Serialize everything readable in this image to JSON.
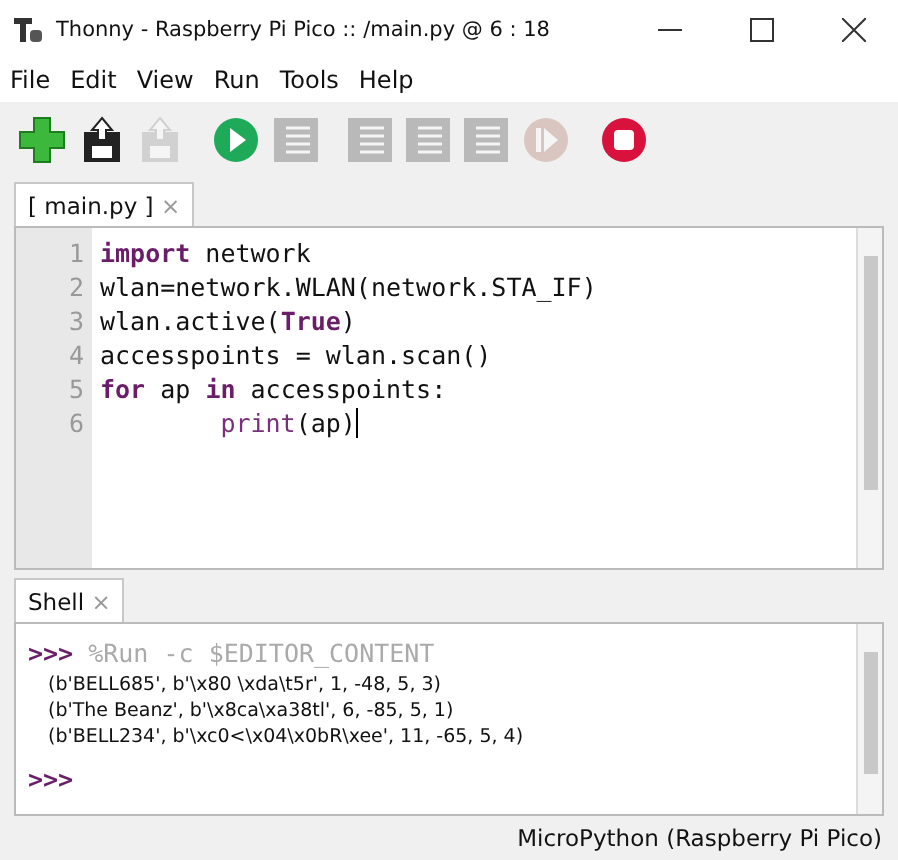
{
  "window": {
    "title": "Thonny  -  Raspberry Pi Pico :: /main.py  @  6 : 18"
  },
  "menu": [
    "File",
    "Edit",
    "View",
    "Run",
    "Tools",
    "Help"
  ],
  "toolbar": [
    {
      "kind": "new",
      "disabled": false
    },
    {
      "kind": "save",
      "disabled": false
    },
    {
      "kind": "upload",
      "disabled": true
    },
    {
      "kind": "run",
      "disabled": false
    },
    {
      "kind": "debug",
      "disabled": true
    },
    {
      "kind": "step-over",
      "disabled": true
    },
    {
      "kind": "step-into",
      "disabled": true
    },
    {
      "kind": "step-out",
      "disabled": true
    },
    {
      "kind": "resume",
      "disabled": true
    },
    {
      "kind": "stop",
      "disabled": false
    }
  ],
  "editor_tabs": [
    {
      "label": "[ main.py ]",
      "close": "×",
      "selected": true
    }
  ],
  "editor": {
    "lines": [
      {
        "number": "1",
        "cursor": false,
        "tokens": [
          {
            "kind": "keyword",
            "text": "import"
          },
          {
            "kind": "plain",
            "text": " network"
          }
        ]
      },
      {
        "number": "2",
        "cursor": false,
        "tokens": [
          {
            "kind": "plain",
            "text": "wlan=network.WLAN(network.STA_IF)"
          }
        ]
      },
      {
        "number": "3",
        "cursor": false,
        "tokens": [
          {
            "kind": "plain",
            "text": "wlan.active("
          },
          {
            "kind": "keyword",
            "text": "True"
          },
          {
            "kind": "plain",
            "text": ")"
          }
        ]
      },
      {
        "number": "4",
        "cursor": false,
        "tokens": [
          {
            "kind": "plain",
            "text": "accesspoints = wlan.scan()"
          }
        ]
      },
      {
        "number": "5",
        "cursor": false,
        "tokens": [
          {
            "kind": "keyword",
            "text": "for"
          },
          {
            "kind": "plain",
            "text": " ap "
          },
          {
            "kind": "keyword",
            "text": "in"
          },
          {
            "kind": "plain",
            "text": " accesspoints:"
          }
        ]
      },
      {
        "number": "6",
        "cursor": true,
        "indented": true,
        "tokens": [
          {
            "kind": "builtin",
            "text": "print"
          },
          {
            "kind": "plain",
            "text": "(ap)"
          }
        ]
      }
    ]
  },
  "shell_tabs": [
    {
      "label": "Shell",
      "close": "×",
      "selected": true
    }
  ],
  "shell": {
    "prompt": ">>>",
    "command": "%Run -c $EDITOR_CONTENT",
    "output": [
      "(b'BELL685', b'\\x80 \\xda\\t5r', 1, -48, 5, 3)",
      "(b'The Beanz', b'\\x8ca\\xa38tl', 6, -85, 5, 1)",
      "(b'BELL234', b'\\xc0<\\x04\\x0bR\\xee', 11, -65, 5, 4)"
    ],
    "final_prompt": ">>>"
  },
  "status_bar": {
    "interpreter": "MicroPython (Raspberry Pi Pico)"
  }
}
